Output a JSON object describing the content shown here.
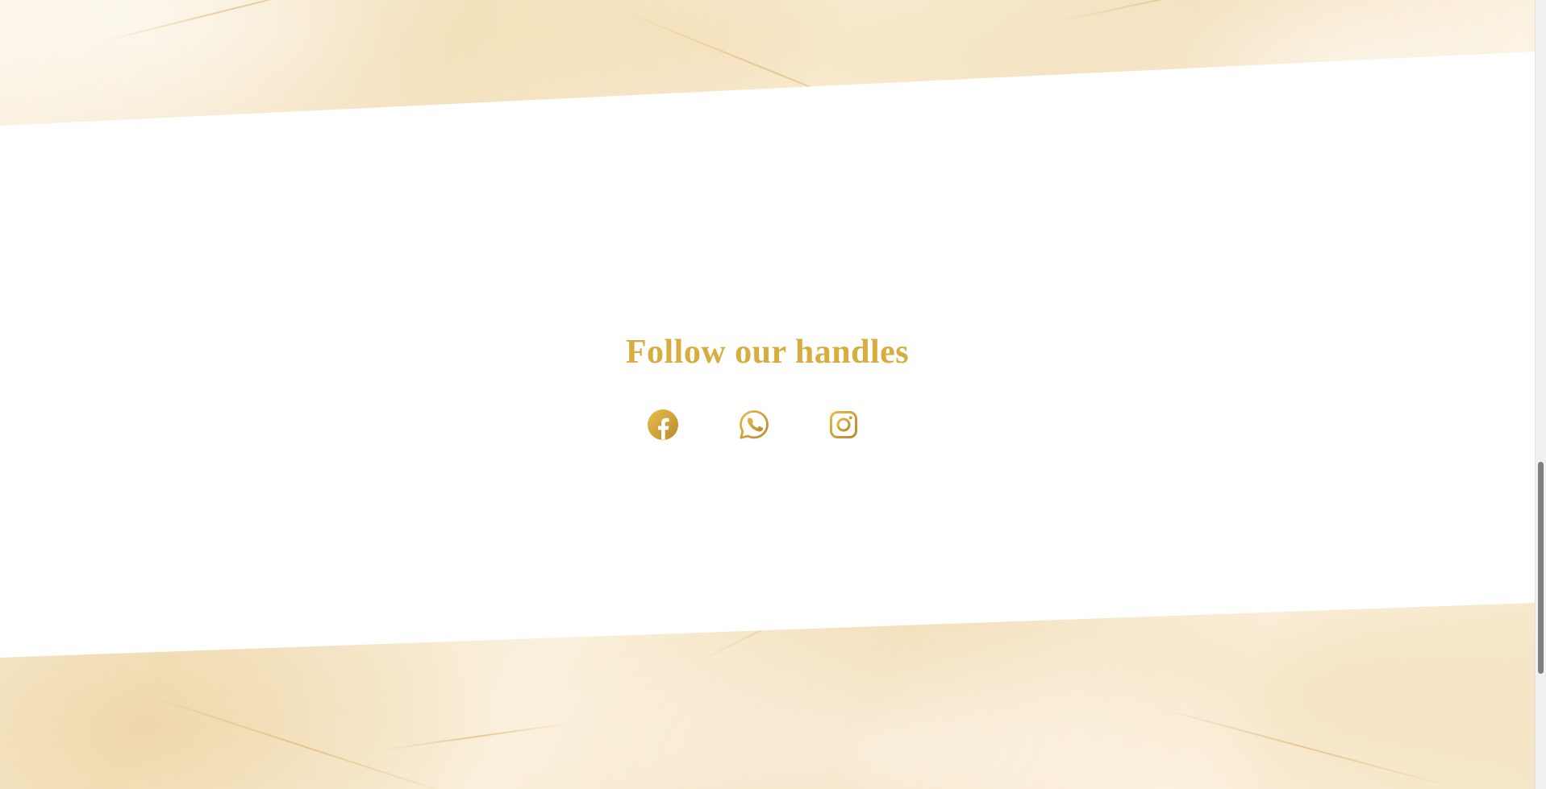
{
  "section": {
    "title": "Follow our handles"
  },
  "social_links": [
    {
      "network": "facebook",
      "icon": "facebook-icon"
    },
    {
      "network": "whatsapp",
      "icon": "whatsapp-icon"
    },
    {
      "network": "instagram",
      "icon": "instagram-icon"
    }
  ],
  "colors": {
    "accent_gold": "#d7ad3f",
    "band": "#ffffff",
    "marble": "#f7ecd6"
  }
}
